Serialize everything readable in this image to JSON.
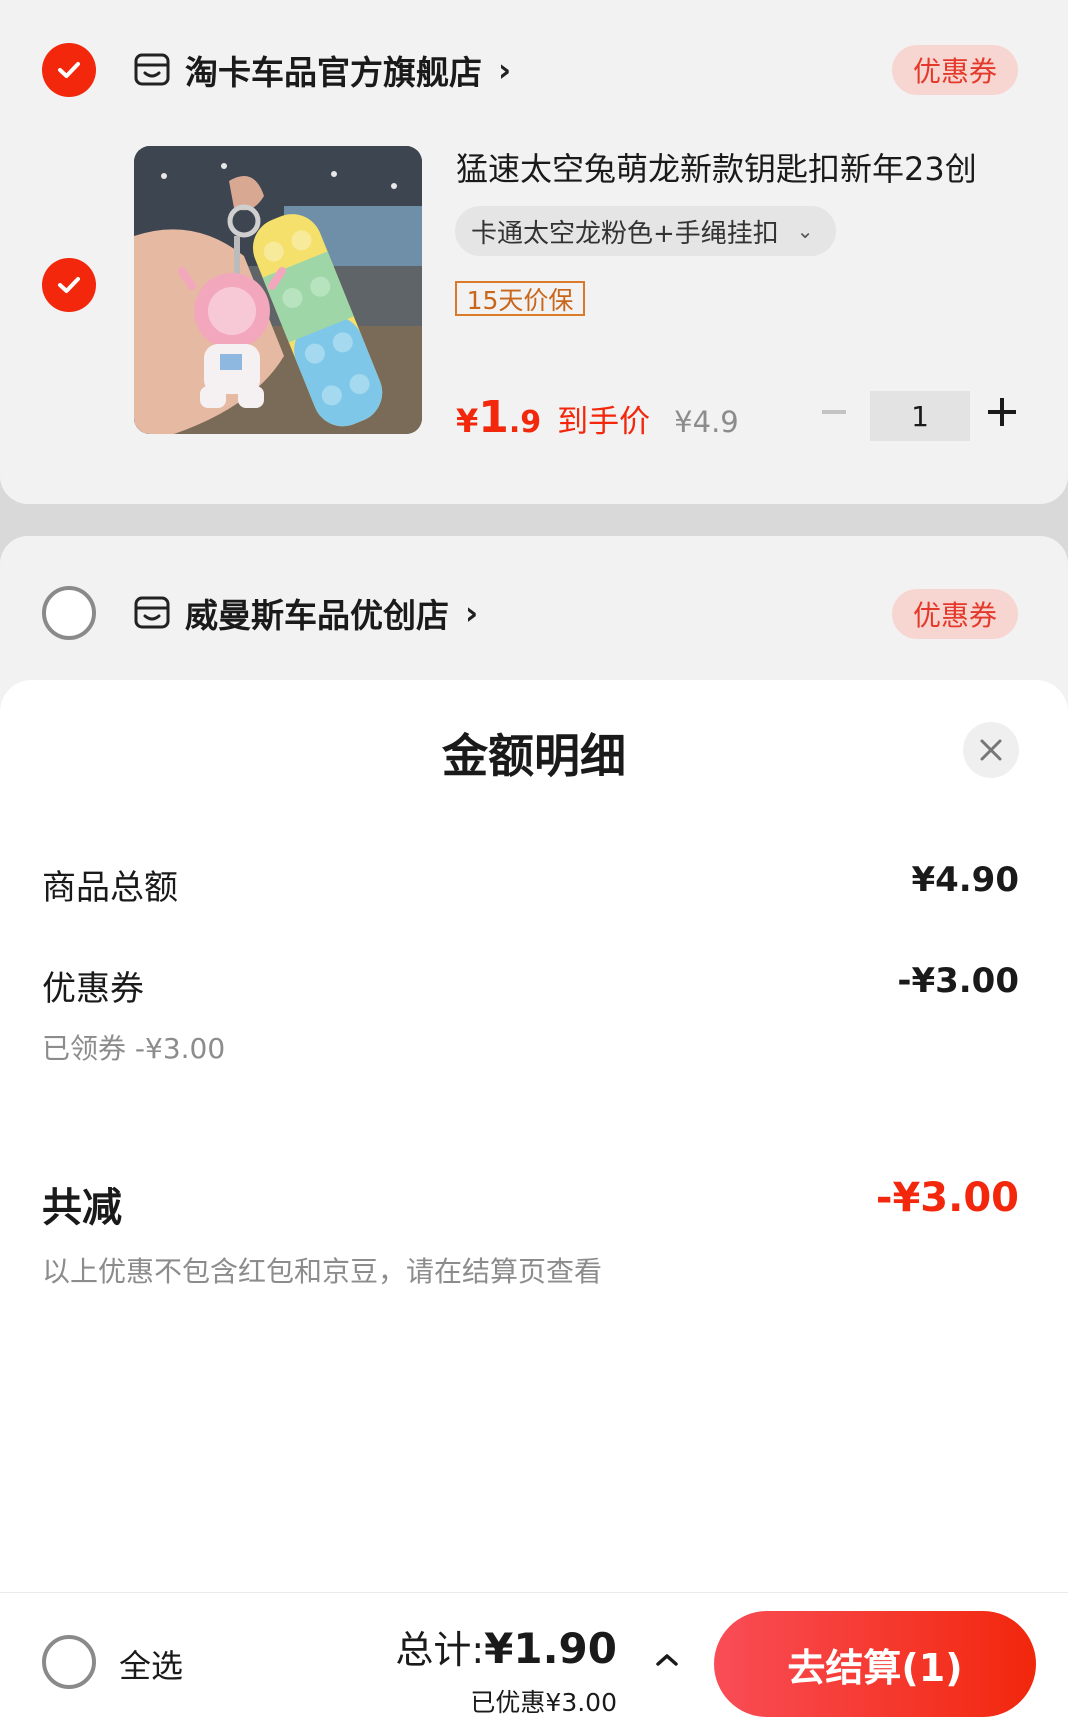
{
  "stores": [
    {
      "name": "淘卡车品官方旗舰店",
      "arrow": "›",
      "coupon_label": "优惠券",
      "selected": true,
      "product": {
        "title": "猛速太空兔萌龙新款钥匙扣新年23创",
        "spec": "卡通太空龙粉色+手绳挂扣",
        "spec_chevron": "⌄",
        "guarantee": "15天价保",
        "price_yen": "¥",
        "price_int": "1",
        "price_dec": ".9",
        "price_tag": "到手价",
        "original_price": "¥4.9",
        "quantity": "1",
        "selected": true
      }
    },
    {
      "name": "威曼斯车品优创店",
      "arrow": "›",
      "coupon_label": "优惠券",
      "selected": false
    }
  ],
  "sheet": {
    "title": "金额明细",
    "rows": {
      "goods_total_label": "商品总额",
      "goods_total_value": "¥4.90",
      "coupon_label": "优惠券",
      "coupon_value": "-¥3.00",
      "coupon_detail": "已领券 -¥3.00",
      "total_off_label": "共减",
      "total_off_value": "-¥3.00",
      "note": "以上优惠不包含红包和京豆，请在结算页查看"
    }
  },
  "bottom_bar": {
    "select_all": "全选",
    "total_prefix": "总计:",
    "total_amount": "¥1.90",
    "saved": "已优惠¥3.00",
    "checkout": "去结算(1)"
  },
  "colors": {
    "accent": "#f2270c",
    "coupon_bg": "#f7d6d2",
    "guarantee": "#d97b2a"
  }
}
